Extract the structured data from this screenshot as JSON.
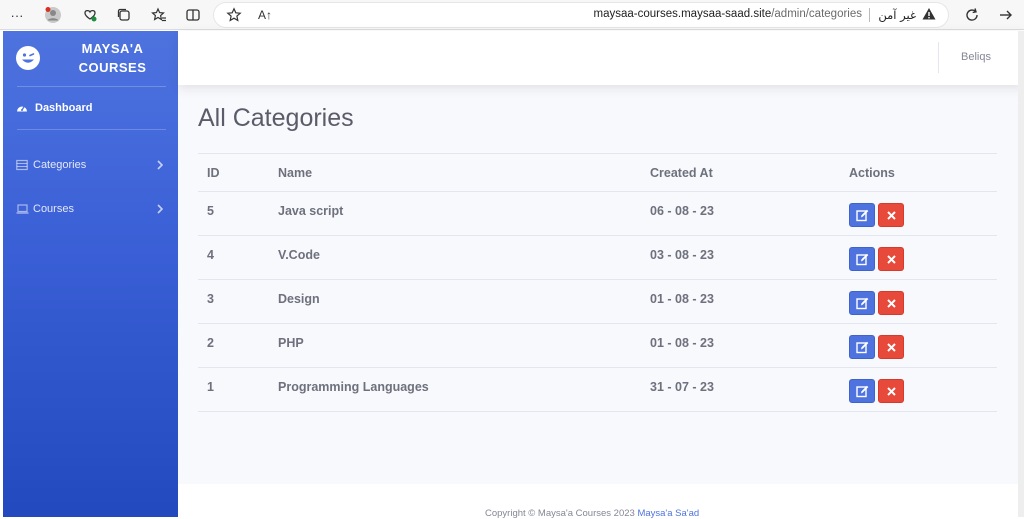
{
  "browser": {
    "url_host": "maysaa-courses.maysaa-saad.site",
    "url_path": "/admin/categories",
    "security_label": "غير آمن",
    "reader_glyph": "A↑"
  },
  "sidebar": {
    "brand_line1": "MAYSA'A",
    "brand_line2": "COURSES",
    "items": [
      {
        "label": "Dashboard",
        "icon": "tachometer-icon",
        "active": true
      },
      {
        "label": "Categories",
        "icon": "table-icon",
        "expandable": true
      },
      {
        "label": "Courses",
        "icon": "laptop-icon",
        "expandable": true
      }
    ]
  },
  "topbar": {
    "user_name": "Beliqs"
  },
  "page": {
    "title": "All Categories"
  },
  "table": {
    "headers": [
      "ID",
      "Name",
      "Created At",
      "Actions"
    ],
    "rows": [
      {
        "id": "5",
        "name": "Java script",
        "created_at": "06 - 08 - 23"
      },
      {
        "id": "4",
        "name": "V.Code",
        "created_at": "03 - 08 - 23"
      },
      {
        "id": "3",
        "name": "Design",
        "created_at": "01 - 08 - 23"
      },
      {
        "id": "2",
        "name": "PHP",
        "created_at": "01 - 08 - 23"
      },
      {
        "id": "1",
        "name": "Programming Languages",
        "created_at": "31 - 07 - 23"
      }
    ]
  },
  "footer": {
    "copyright": "Copyright © Maysa'a Courses 2023 ",
    "author_link": "Maysa'a Sa'ad"
  },
  "colors": {
    "primary": "#4e73df",
    "danger": "#e74a3b",
    "sidebar_gradient_end": "#224abe"
  }
}
